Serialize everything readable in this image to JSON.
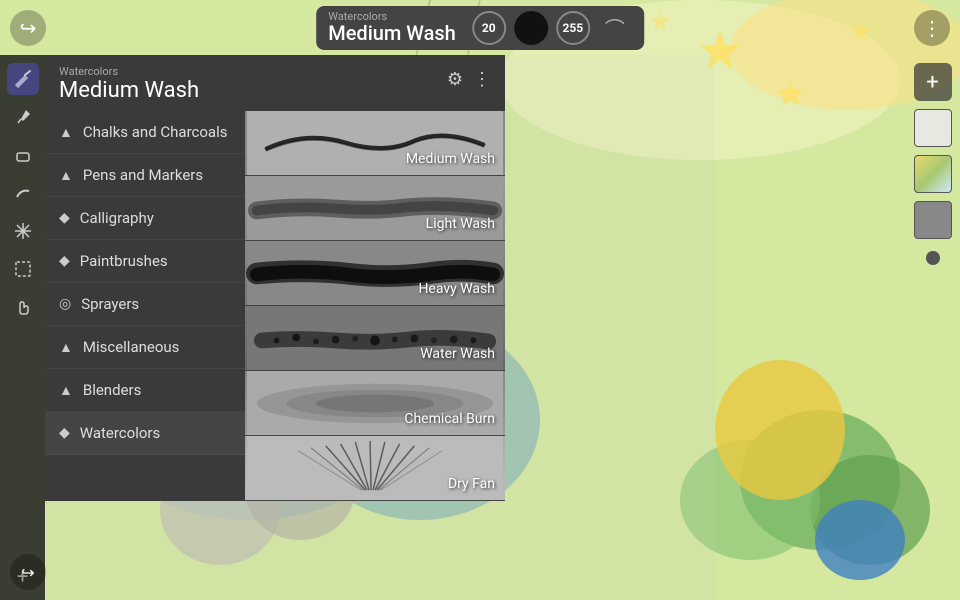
{
  "app": {
    "title": "Watercolors",
    "brush_name": "Medium Wash"
  },
  "toolbar": {
    "category": "Watercolors",
    "brush": "Medium Wash",
    "size_small": "20",
    "size_large": "255",
    "more_icon": "⋮",
    "undo_icon": "↩",
    "redo_icon": "↩",
    "curve_icon": "⌒"
  },
  "panel": {
    "subtitle": "Watercolors",
    "title": "Medium Wash",
    "settings_icon": "⚙",
    "more_icon": "⋮"
  },
  "categories": [
    {
      "id": "chalks",
      "label": "Chalks and Charcoals",
      "icon": "▲"
    },
    {
      "id": "pens",
      "label": "Pens and Markers",
      "icon": "▲"
    },
    {
      "id": "calligraphy",
      "label": "Calligraphy",
      "icon": "◆"
    },
    {
      "id": "paintbrushes",
      "label": "Paintbrushes",
      "icon": "◆"
    },
    {
      "id": "sprayers",
      "label": "Sprayers",
      "icon": "◎"
    },
    {
      "id": "miscellaneous",
      "label": "Miscellaneous",
      "icon": "▲"
    },
    {
      "id": "blenders",
      "label": "Blenders",
      "icon": "▲"
    },
    {
      "id": "watercolors",
      "label": "Watercolors",
      "icon": "◆",
      "active": true
    }
  ],
  "brushes": [
    {
      "id": "medium-wash",
      "label": "Medium Wash",
      "active": true
    },
    {
      "id": "light-wash",
      "label": "Light Wash"
    },
    {
      "id": "heavy-wash",
      "label": "Heavy Wash"
    },
    {
      "id": "water-wash",
      "label": "Water Wash"
    },
    {
      "id": "chemical-burn",
      "label": "Chemical Burn"
    },
    {
      "id": "dry-fan",
      "label": "Dry Fan"
    }
  ],
  "left_tools": [
    {
      "id": "brush",
      "icon": "✏",
      "active": true
    },
    {
      "id": "eyedropper",
      "icon": "⊕"
    },
    {
      "id": "eraser",
      "icon": "◯"
    },
    {
      "id": "smudge",
      "icon": "✋"
    },
    {
      "id": "transform",
      "icon": "✥"
    },
    {
      "id": "select",
      "icon": "⬚"
    },
    {
      "id": "hand",
      "icon": "✋"
    },
    {
      "id": "settings",
      "icon": "+"
    }
  ]
}
